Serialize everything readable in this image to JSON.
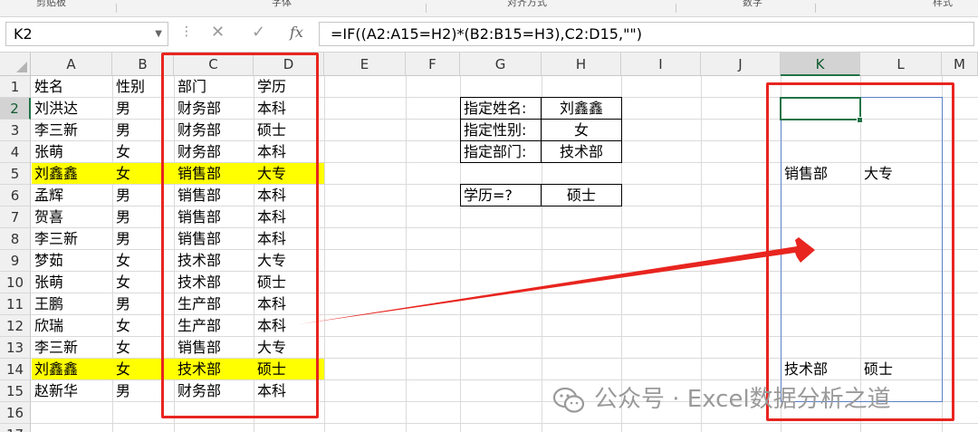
{
  "ribbon": {
    "fragments": [
      "剪贴板",
      "字体",
      "对齐方式",
      "数字",
      "样式"
    ]
  },
  "formula_bar": {
    "name_box": "K2",
    "cancel_icon": "✕",
    "enter_icon": "✓",
    "fx_label": "fx",
    "formula": "=IF((A2:A15=H2)*(B2:B15=H3),C2:D15,\"\")"
  },
  "columns": [
    "A",
    "B",
    "C",
    "D",
    "E",
    "F",
    "G",
    "H",
    "I",
    "J",
    "K",
    "L",
    "M"
  ],
  "rows": [
    "1",
    "2",
    "3",
    "4",
    "5",
    "6",
    "7",
    "8",
    "9",
    "10",
    "11",
    "12",
    "13",
    "14",
    "15",
    "16",
    "17"
  ],
  "table": {
    "headers": [
      "姓名",
      "性别",
      "部门",
      "学历"
    ],
    "rows": [
      [
        "刘洪达",
        "男",
        "财务部",
        "本科"
      ],
      [
        "李三新",
        "男",
        "财务部",
        "硕士"
      ],
      [
        "张萌",
        "女",
        "财务部",
        "本科"
      ],
      [
        "刘鑫鑫",
        "女",
        "销售部",
        "大专"
      ],
      [
        "孟辉",
        "男",
        "销售部",
        "本科"
      ],
      [
        "贺喜",
        "男",
        "销售部",
        "本科"
      ],
      [
        "李三新",
        "男",
        "销售部",
        "本科"
      ],
      [
        "梦茹",
        "女",
        "技术部",
        "大专"
      ],
      [
        "张萌",
        "女",
        "技术部",
        "硕士"
      ],
      [
        "王鹏",
        "男",
        "生产部",
        "本科"
      ],
      [
        "欣瑞",
        "女",
        "生产部",
        "本科"
      ],
      [
        "李三新",
        "女",
        "销售部",
        "大专"
      ],
      [
        "刘鑫鑫",
        "女",
        "技术部",
        "硕士"
      ],
      [
        "赵新华",
        "男",
        "财务部",
        "本科"
      ]
    ],
    "highlight_color": "#ffff00"
  },
  "criteria": {
    "name_label": "指定姓名:",
    "name_value": "刘鑫鑫",
    "gender_label": "指定性别:",
    "gender_value": "女",
    "dept_label": "指定部门:",
    "dept_value": "技术部",
    "edu_label": "学历=?",
    "edu_value": "硕士"
  },
  "results": [
    {
      "dept": "销售部",
      "edu": "大专"
    },
    {
      "dept": "技术部",
      "edu": "硕士"
    }
  ],
  "watermark": "公众号 · Excel数据分析之道",
  "accent_colors": {
    "annotation_red": "#e8251f",
    "selection_green": "#217346",
    "spill_blue": "#5b7fc7"
  }
}
